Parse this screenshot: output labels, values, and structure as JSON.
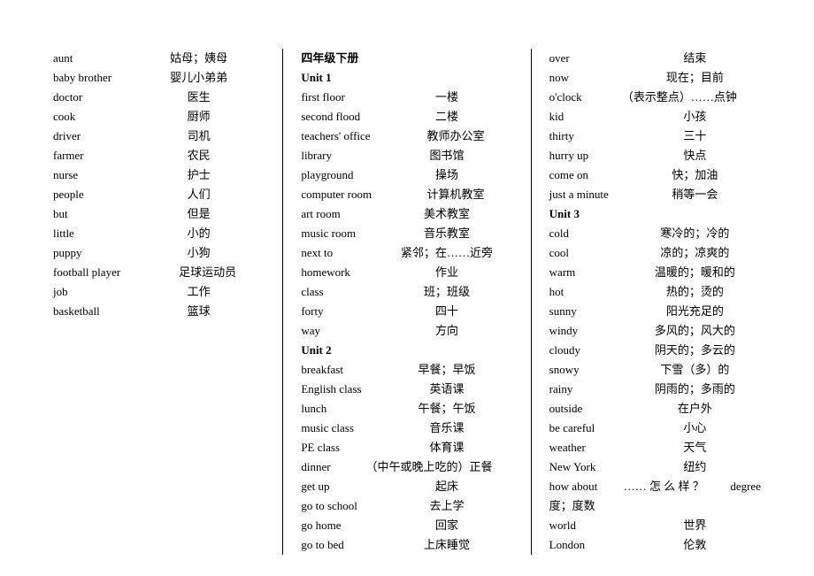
{
  "col1": [
    {
      "term": "aunt",
      "def": "姑母；姨母"
    },
    {
      "term": "baby brother",
      "def": "婴儿小弟弟"
    },
    {
      "term": "doctor",
      "def": "医生"
    },
    {
      "term": "cook",
      "def": "厨师"
    },
    {
      "term": "driver",
      "def": "司机"
    },
    {
      "term": "farmer",
      "def": "农民"
    },
    {
      "term": "nurse",
      "def": "护士"
    },
    {
      "term": "people",
      "def": "人们"
    },
    {
      "term": "but",
      "def": "但是"
    },
    {
      "term": "little",
      "def": "小的"
    },
    {
      "term": "puppy",
      "def": "小狗"
    },
    {
      "term": "football player",
      "def": "足球运动员"
    },
    {
      "term": "job",
      "def": "工作"
    },
    {
      "term": "basketball",
      "def": "篮球"
    }
  ],
  "col2_title": "四年级下册",
  "col2_unit1": "Unit 1",
  "col2_u1": [
    {
      "term": "first floor",
      "def": "一楼"
    },
    {
      "term": "second flood",
      "def": "二楼"
    },
    {
      "term": "teachers' office",
      "def": "教师办公室"
    },
    {
      "term": "library",
      "def": "图书馆"
    },
    {
      "term": "playground",
      "def": "操场"
    },
    {
      "term": "computer room",
      "def": "计算机教室"
    },
    {
      "term": "art room",
      "def": "美术教室"
    },
    {
      "term": "music room",
      "def": "音乐教室"
    },
    {
      "term": "next to",
      "def": "紧邻；在……近旁"
    },
    {
      "term": "homework",
      "def": "作业"
    },
    {
      "term": "class",
      "def": "班；班级"
    },
    {
      "term": "forty",
      "def": "四十"
    },
    {
      "term": "way",
      "def": "方向"
    }
  ],
  "col2_unit2": "Unit 2",
  "col2_u2": [
    {
      "term": "breakfast",
      "def": "早餐；早饭"
    },
    {
      "term": "English class",
      "def": "英语课"
    },
    {
      "term": "lunch",
      "def": "午餐；午饭"
    },
    {
      "term": "music class",
      "def": "音乐课"
    },
    {
      "term": "PE class",
      "def": "体育课"
    },
    {
      "term": "dinner",
      "def": "（中午或晚上吃的）正餐"
    },
    {
      "term": "get up",
      "def": "起床"
    },
    {
      "term": "go to school",
      "def": "去上学"
    },
    {
      "term": "go home",
      "def": "回家"
    },
    {
      "term": "go to bed",
      "def": "上床睡觉"
    }
  ],
  "col3_a": [
    {
      "term": "over",
      "def": "结束"
    },
    {
      "term": "now",
      "def": "现在；目前"
    },
    {
      "term": "o'clock",
      "def": "（表示整点）……点钟"
    },
    {
      "term": "kid",
      "def": "小孩"
    },
    {
      "term": "thirty",
      "def": "三十"
    },
    {
      "term": "hurry up",
      "def": "快点"
    },
    {
      "term": "come on",
      "def": "快；加油"
    },
    {
      "term": "just a minute",
      "def": "稍等一会"
    }
  ],
  "col3_unit3": "Unit 3",
  "col3_b": [
    {
      "term": "cold",
      "def": "寒冷的；冷的"
    },
    {
      "term": "cool",
      "def": "凉的；凉爽的"
    },
    {
      "term": "warm",
      "def": "温暖的；暖和的"
    },
    {
      "term": "hot",
      "def": "热的；烫的"
    },
    {
      "term": "sunny",
      "def": "阳光充足的"
    },
    {
      "term": "windy",
      "def": "多风的；风大的"
    },
    {
      "term": "cloudy",
      "def": "阴天的；多云的"
    },
    {
      "term": "snowy",
      "def": "下雪（多）的"
    },
    {
      "term": "rainy",
      "def": "阴雨的；多雨的"
    },
    {
      "term": "outside",
      "def": "在户外"
    },
    {
      "term": "be careful",
      "def": "小心"
    },
    {
      "term": "weather",
      "def": "天气"
    },
    {
      "term": "New York",
      "def": "纽约"
    }
  ],
  "col3_special": {
    "a": "how  about",
    "b": "…… 怎 么 样 ？",
    "c": "degree"
  },
  "col3_sp2": "度；度数",
  "col3_c": [
    {
      "term": "world",
      "def": "世界"
    },
    {
      "term": "London",
      "def": "伦敦"
    }
  ]
}
